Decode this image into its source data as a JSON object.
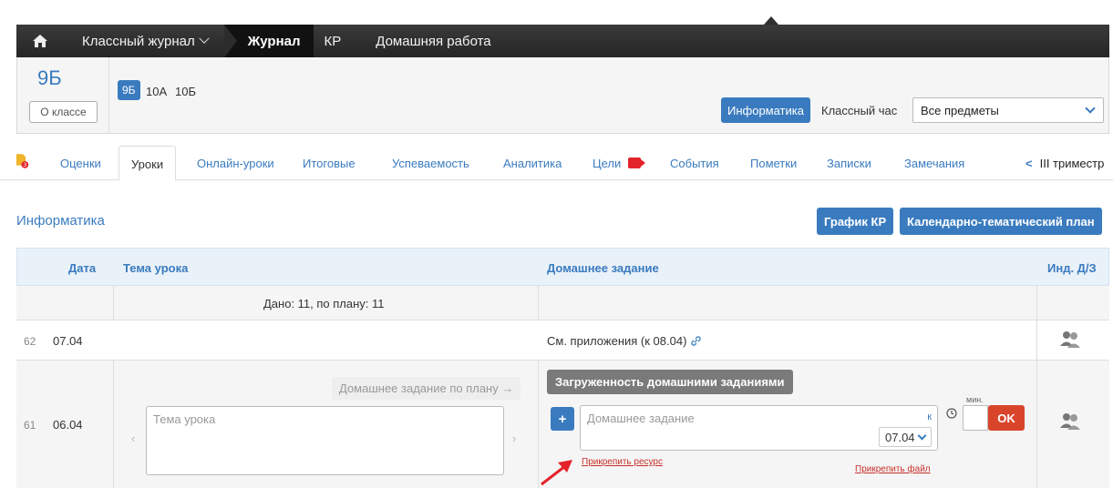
{
  "topnav": {
    "journal_menu": "Классный журнал",
    "journal": "Журнал",
    "kr": "КР",
    "homework": "Домашняя работа"
  },
  "classpanel": {
    "current_class": "9Б",
    "about_button": "О классе",
    "classes": [
      "9Б",
      "10А",
      "10Б"
    ],
    "subject_button": "Информатика",
    "class_hour": "Классный час",
    "subject_select": "Все предметы"
  },
  "tabs": {
    "notification_count": "3",
    "items": [
      "Оценки",
      "Уроки",
      "Онлайн-уроки",
      "Итоговые",
      "Успеваемость",
      "Аналитика",
      "Цели",
      "События",
      "Пометки",
      "Записки",
      "Замечания"
    ],
    "active": "Уроки",
    "trimester": "III триместр"
  },
  "section": {
    "title": "Информатика",
    "kr_schedule": "График КР",
    "calendar_plan": "Календарно-тематический план"
  },
  "table": {
    "headers": {
      "date": "Дата",
      "topic": "Тема урока",
      "homework": "Домашнее задание",
      "individual": "Инд. Д/З"
    },
    "summary": "Дано: 11, по плану: 11",
    "rows": [
      {
        "num": "62",
        "date": "07.04",
        "homework": "См. приложения (к 08.04)"
      },
      {
        "num": "61",
        "date": "06.04"
      }
    ],
    "edit": {
      "homework_plan_button": "Домашнее задание по плану",
      "topic_placeholder": "Тема урока",
      "load_tooltip": "Загруженность домашними заданиями",
      "plus": "+",
      "homework_placeholder": "Домашнее задание",
      "to_label": "к",
      "due_date": "07.04",
      "minutes_label": "мин.",
      "ok": "OK",
      "attach_resource": "Прикрепить ресурс",
      "attach_file": "Прикрепить файл"
    }
  },
  "colors": {
    "accent": "#3a7bbf",
    "danger": "#d9452b",
    "nav_dark": "#262626"
  }
}
